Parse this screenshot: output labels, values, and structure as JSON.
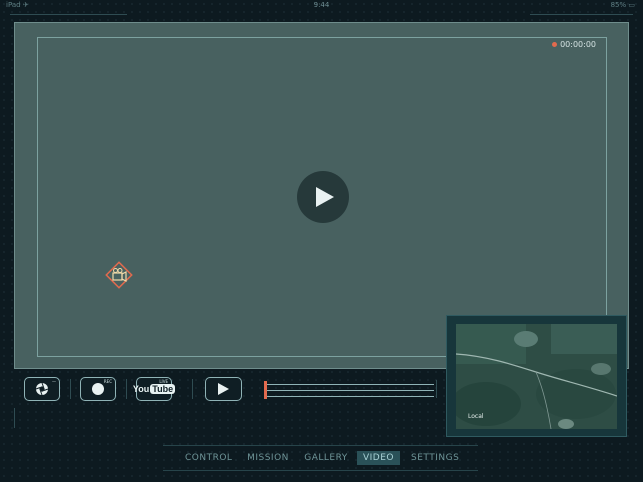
{
  "status_bar": {
    "carrier": "iPad ✈",
    "time": "9:44",
    "battery": "85% ▭"
  },
  "video": {
    "recording_time": "00:00:00",
    "recording_color": "#e26a4e",
    "center_control": "play-icon"
  },
  "controls": {
    "youtube_you": "You",
    "youtube_tube": "Tube",
    "youtube_badge": "LIVE",
    "record_badge": "REC",
    "timeline_progress": 0,
    "accent": "#e26a4e"
  },
  "minimap": {
    "label": "Local"
  },
  "tabs": [
    {
      "label": "CONTROL",
      "active": false
    },
    {
      "label": "MISSION",
      "active": false
    },
    {
      "label": "GALLERY",
      "active": false
    },
    {
      "label": "VIDEO",
      "active": true
    },
    {
      "label": "SETTINGS",
      "active": false
    }
  ]
}
